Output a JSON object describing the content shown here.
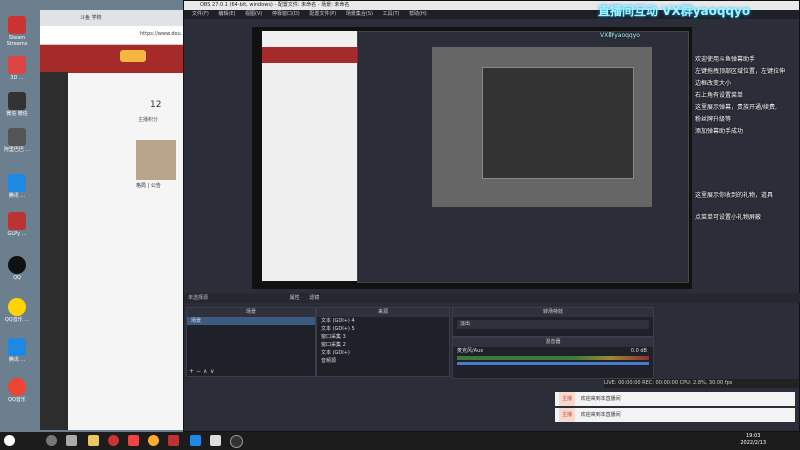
{
  "desktop": {
    "icons": [
      "Steam\nStreams",
      "3D\n...",
      "微信\n微信",
      "阿里巴巴\n...",
      "腾讯\n...",
      "GLPy\n...",
      "QQ",
      "QQ音乐\n...",
      "腾讯\n...",
      "QQ音乐"
    ]
  },
  "browser": {
    "tab_label": "斗鱼 学校",
    "address": "https://www.dou...",
    "follow_count": "12",
    "follow_label": "主播积分",
    "streamer_label": "格局 | 公告"
  },
  "obs": {
    "title": "OBS 27.0.1 (64-bit, windows) - 配置文件: 未命名 - 场景: 未命名",
    "menu": [
      "文件(F)",
      "编辑(E)",
      "视图(V)",
      "停靠窗口(D)",
      "配置文件(P)",
      "场景集合(S)",
      "工具(T)",
      "帮助(H)"
    ],
    "no_source": "未选择源",
    "props_label": "属性",
    "filter_label": "滤镜",
    "scenes_header": "场景",
    "scene_item": "场景",
    "sources_header": "来源",
    "sources": [
      "文本 (GDI+) 4",
      "文本 (GDI+) 5",
      "窗口采集 3",
      "窗口采集 2",
      "文本 (GDI+)",
      "音频源"
    ],
    "transition_header": "转场特效",
    "transition_value": "淡出",
    "mixer_header": "混音器",
    "mixer_track": "麦克风/Aux",
    "mixer_db": "0.0 dB",
    "status": "LIVE: 00:00:00   REC: 00:00:00   CPU: 2.8%, 30.00 fps"
  },
  "overlay": {
    "banner": "直播间互动 VX群yaoqqyo",
    "banner_sub": "VX群yaoqqyo",
    "lines": [
      "欢迎使用斗鱼弹幕助手",
      "左键拖拽顶部区域位置，左键拉伸",
      "边框改变大小",
      "右上角有设置菜单",
      "这里展示弹幕，贵族开通/续费,",
      "粉丝牌升级等",
      "添加弹幕助手成功",
      "这里展示你收到的礼物，道具",
      "点菜单可设置小礼物屏蔽"
    ]
  },
  "chat": [
    {
      "badge": "主播",
      "text": "欢迎来到本直播间"
    },
    {
      "badge": "主播",
      "text": "欢迎来到本直播间"
    }
  ],
  "taskbar": {
    "time": "19:03",
    "date": "2022/2/13"
  }
}
